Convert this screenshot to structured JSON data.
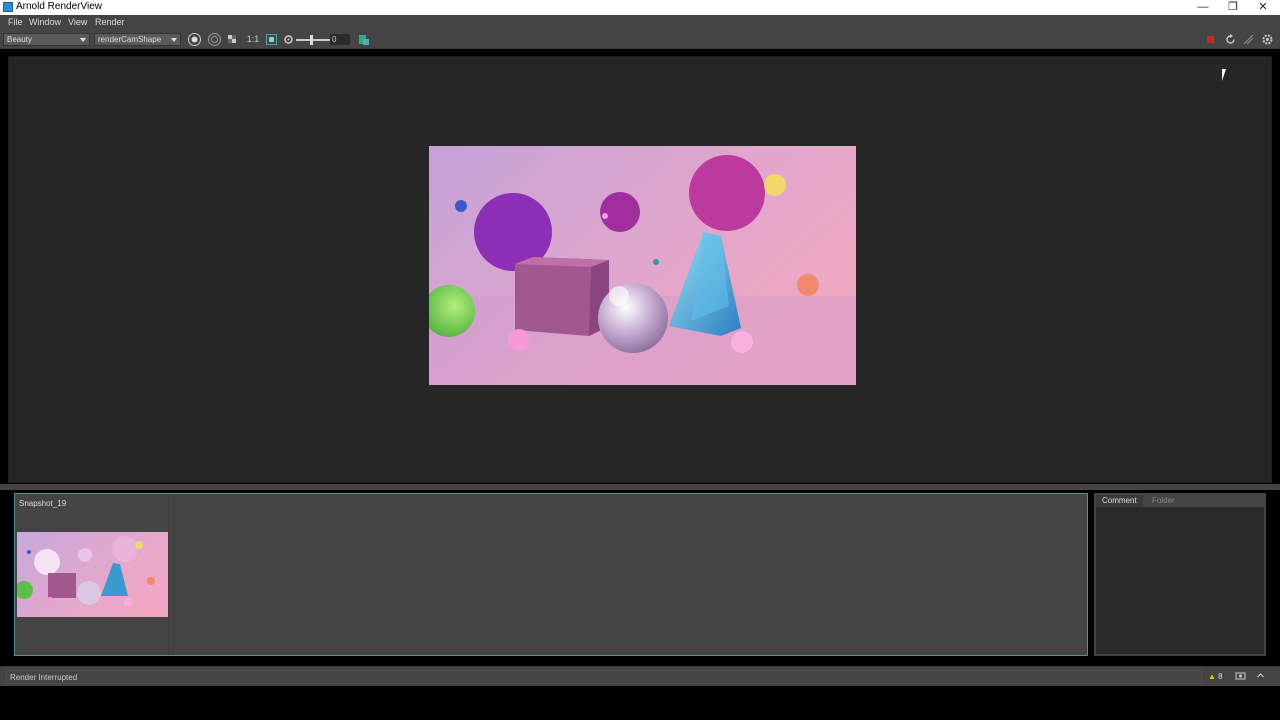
{
  "window": {
    "title": "Arnold RenderView",
    "minimize": "—",
    "maximize": "❐",
    "close": "✕"
  },
  "menu": {
    "file": "File",
    "window": "Window",
    "view": "View",
    "render": "Render"
  },
  "toolbar": {
    "aov_select": "Beauty",
    "camera_select": "renderCamShape",
    "ratio_label": "1:1",
    "exposure_value": "0"
  },
  "snapshot": {
    "label": "Snapshot_19"
  },
  "side_panel": {
    "tabs": [
      "Comment",
      "Folder"
    ]
  },
  "status": {
    "message": "Render Interrupted",
    "warning_count": "8"
  },
  "colors": {
    "accent_border": "#5a8a96",
    "warning": "#e8c31a",
    "stop_red": "#c62828"
  }
}
